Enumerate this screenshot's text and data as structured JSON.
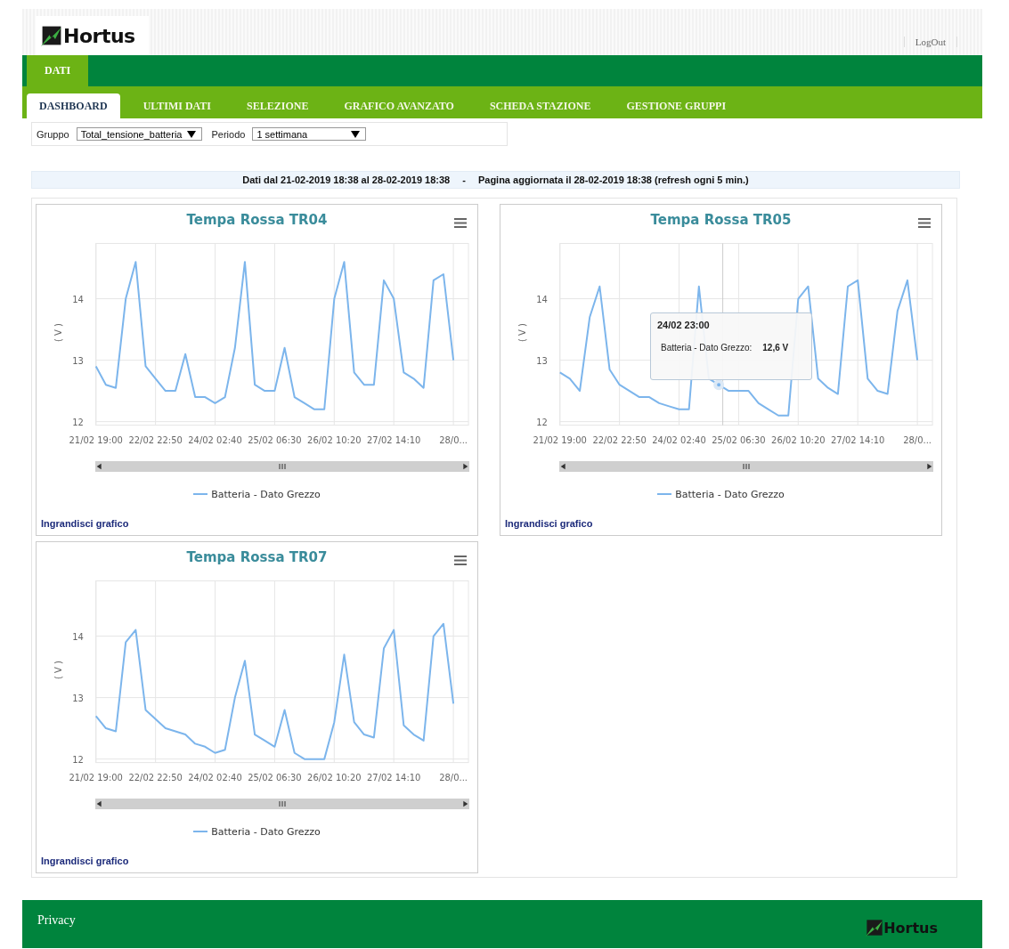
{
  "header": {
    "logo": "Hortus",
    "logout": "LogOut"
  },
  "main_tabs": [
    {
      "label": "DATI",
      "selected": true
    }
  ],
  "sub_tabs": [
    {
      "label": "DASHBOARD",
      "selected": true
    },
    {
      "label": "ULTIMI DATI",
      "selected": false
    },
    {
      "label": "SELEZIONE",
      "selected": false
    },
    {
      "label": "GRAFICO AVANZATO",
      "selected": false
    },
    {
      "label": "SCHEDA STAZIONE",
      "selected": false
    },
    {
      "label": "GESTIONE GRUPPI",
      "selected": false
    }
  ],
  "filters": [
    {
      "label": "Gruppo",
      "value": "Total_tensione_batteria"
    },
    {
      "label": "Periodo",
      "value": "1 settimana"
    }
  ],
  "info": {
    "range": "Dati dal 21-02-2019 18:38 al 28-02-2019 18:38",
    "separator": "-",
    "updated": "Pagina aggiornata il 28-02-2019 18:38 (refresh ogni 5 min.)"
  },
  "charts": [
    {
      "title": "Tempa Rossa TR04",
      "link": "Ingrandisci grafico",
      "chart_data": {
        "type": "line",
        "grid": true,
        "ylabel": "( V )",
        "ylim": [
          12,
          14.9
        ],
        "yticks": [
          12,
          13,
          14
        ],
        "categories": [
          "21/02 19:00",
          null,
          null,
          null,
          null,
          null,
          "22/02 22:50",
          null,
          null,
          null,
          null,
          null,
          "24/02 02:40",
          null,
          null,
          null,
          null,
          null,
          "25/02 06:30",
          null,
          null,
          null,
          null,
          null,
          "26/02 10:20",
          null,
          null,
          null,
          null,
          null,
          "27/02 14:10",
          null,
          null,
          null,
          null,
          null,
          "28/0..."
        ],
        "series": [
          {
            "name": "Batteria - Dato Grezzo",
            "color": "#7cb5ec",
            "values": [
              12.9,
              12.6,
              12.55,
              14.0,
              14.6,
              12.9,
              12.7,
              12.5,
              12.5,
              13.1,
              12.4,
              12.4,
              12.3,
              12.4,
              13.2,
              14.6,
              12.6,
              12.5,
              12.5,
              13.2,
              12.4,
              12.3,
              12.2,
              12.2,
              14.0,
              14.6,
              12.8,
              12.6,
              12.6,
              14.3,
              14.0,
              12.8,
              12.7,
              12.55,
              14.3,
              14.4,
              13.0
            ]
          }
        ]
      }
    },
    {
      "title": "Tempa Rossa TR05",
      "link": "Ingrandisci grafico",
      "tooltip": {
        "title": "24/02 23:00",
        "label": "Batteria - Dato Grezzo:",
        "value": "12,6 V"
      },
      "chart_data": {
        "type": "line",
        "grid": true,
        "ylabel": "( V )",
        "ylim": [
          12,
          14.9
        ],
        "yticks": [
          12,
          13,
          14
        ],
        "categories": [
          "21/02 19:00",
          null,
          null,
          null,
          null,
          null,
          "22/02 22:50",
          null,
          null,
          null,
          null,
          null,
          "24/02 02:40",
          null,
          null,
          null,
          null,
          null,
          "25/02 06:30",
          null,
          null,
          null,
          null,
          null,
          "26/02 10:20",
          null,
          null,
          null,
          null,
          null,
          "27/02 14:10",
          null,
          null,
          null,
          null,
          null,
          "28/0..."
        ],
        "series": [
          {
            "name": "Batteria - Dato Grezzo",
            "color": "#7cb5ec",
            "values": [
              12.8,
              12.7,
              12.5,
              13.7,
              14.2,
              12.85,
              12.6,
              12.5,
              12.4,
              12.4,
              12.3,
              12.25,
              12.2,
              12.2,
              14.2,
              12.7,
              12.6,
              12.5,
              12.5,
              12.5,
              12.3,
              12.2,
              12.1,
              12.1,
              14.0,
              14.2,
              12.7,
              12.55,
              12.45,
              14.2,
              14.3,
              12.7,
              12.5,
              12.45,
              13.8,
              14.3,
              13.0
            ]
          }
        ]
      }
    },
    {
      "title": "Tempa Rossa TR07",
      "link": "Ingrandisci grafico",
      "chart_data": {
        "type": "line",
        "grid": true,
        "ylabel": "( V )",
        "ylim": [
          12,
          14.9
        ],
        "yticks": [
          12,
          13,
          14
        ],
        "categories": [
          "21/02 19:00",
          null,
          null,
          null,
          null,
          null,
          "22/02 22:50",
          null,
          null,
          null,
          null,
          null,
          "24/02 02:40",
          null,
          null,
          null,
          null,
          null,
          "25/02 06:30",
          null,
          null,
          null,
          null,
          null,
          "26/02 10:20",
          null,
          null,
          null,
          null,
          null,
          "27/02 14:10",
          null,
          null,
          null,
          null,
          null,
          "28/0..."
        ],
        "series": [
          {
            "name": "Batteria - Dato Grezzo",
            "color": "#7cb5ec",
            "values": [
              12.7,
              12.5,
              12.45,
              13.9,
              14.1,
              12.8,
              12.65,
              12.5,
              12.45,
              12.4,
              12.25,
              12.2,
              12.1,
              12.15,
              13.0,
              13.6,
              12.4,
              12.3,
              12.2,
              12.8,
              12.1,
              12.0,
              12.0,
              12.0,
              12.6,
              13.7,
              12.6,
              12.4,
              12.35,
              13.8,
              14.1,
              12.55,
              12.4,
              12.3,
              14.0,
              14.2,
              12.9
            ]
          }
        ]
      }
    }
  ],
  "footer": {
    "link": "Privacy",
    "logo": "Hortus"
  }
}
